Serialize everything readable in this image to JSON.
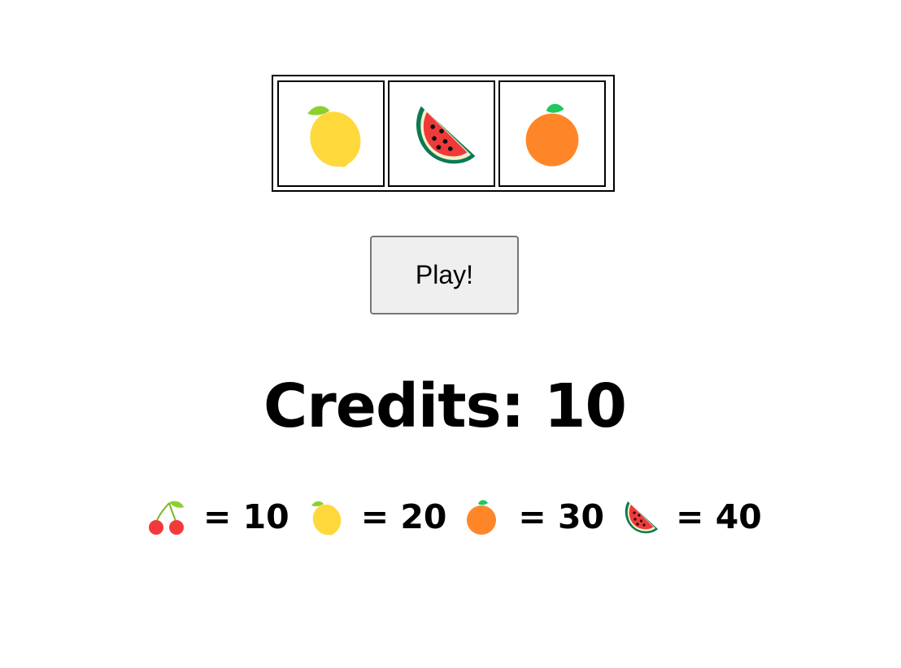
{
  "reels": [
    {
      "symbol": "lemon-icon"
    },
    {
      "symbol": "watermelon-icon"
    },
    {
      "symbol": "orange-icon"
    }
  ],
  "play_button": {
    "label": "Play!"
  },
  "credits": {
    "text": "Credits: 10"
  },
  "paytable": [
    {
      "symbol": "cherry-icon",
      "text": "= 10"
    },
    {
      "symbol": "lemon-icon",
      "text": "= 20"
    },
    {
      "symbol": "orange-icon",
      "text": "= 30"
    },
    {
      "symbol": "watermelon-icon",
      "text": "= 40"
    }
  ],
  "colors": {
    "lemon": "#ffd83b",
    "leaf": "#8cd02c",
    "orange": "#ff8628",
    "orange_leaf": "#1fc95b",
    "watermelon_rind": "#0a7a52",
    "watermelon_flesh": "#f03a3a",
    "cherry": "#f33a3a"
  }
}
